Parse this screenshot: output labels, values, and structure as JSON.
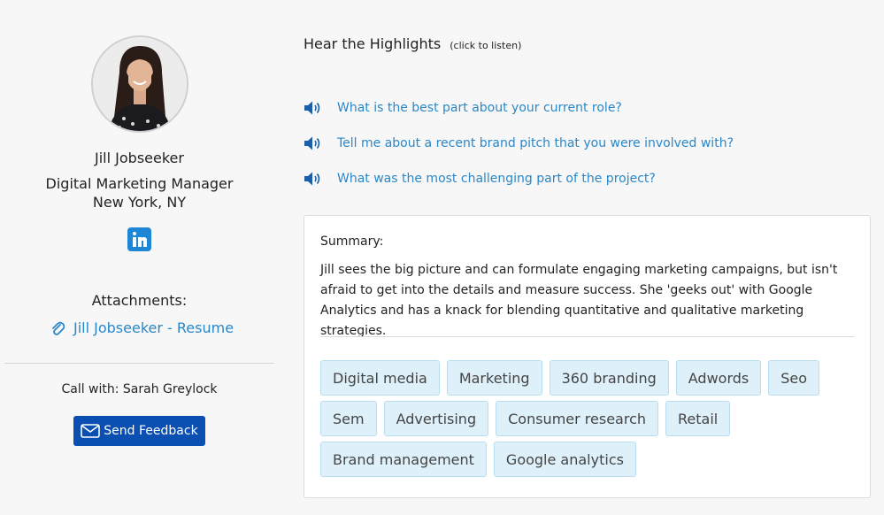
{
  "profile": {
    "name": "Jill Jobseeker",
    "title": "Digital Marketing Manager",
    "location": "New York, NY",
    "attachments_label": "Attachments:",
    "resume_link": "Jill Jobseeker - Resume",
    "call_with": "Call with: Sarah Greylock",
    "send_feedback": "Send Feedback"
  },
  "highlights": {
    "title": "Hear the Highlights",
    "hint": "(click to listen)",
    "questions": [
      "What is the best part about your current role?",
      "Tell me about a recent brand pitch that you were involved with?",
      "What was the most challenging part of the project?"
    ]
  },
  "summary": {
    "label": "Summary:",
    "text": "Jill sees the big picture and can formulate engaging marketing campaigns, but isn't afraid to get into the details and measure success. She 'geeks out' with Google Analytics and has a knack for blending quantitative and qualitative marketing strategies.",
    "tags": [
      "Digital media",
      "Marketing",
      "360 branding",
      "Adwords",
      "Seo",
      "Sem",
      "Advertising",
      "Consumer research",
      "Retail",
      "Brand management",
      "Google analytics"
    ]
  },
  "colors": {
    "link": "#2a87c8",
    "button": "#0b4fb3",
    "tag_bg": "#def1fa",
    "linkedin": "#1d86d6"
  },
  "icons": {
    "linkedin": "linkedin-icon",
    "attachment": "paperclip-icon",
    "speaker": "speaker-icon",
    "feedback": "envelope-icon"
  }
}
